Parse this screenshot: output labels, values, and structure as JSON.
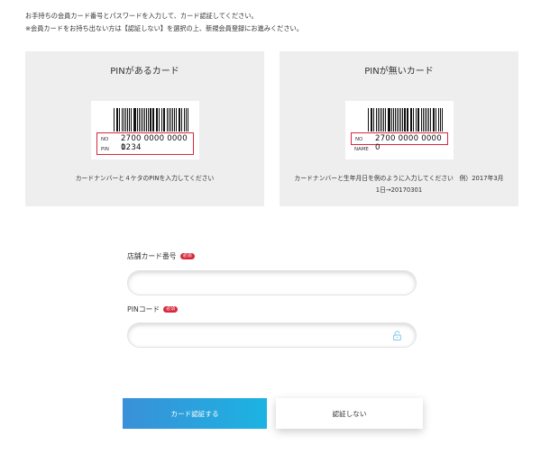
{
  "intro": {
    "line1": "お手持ちの会員カード番号とパスワードを入力して、カード認証してください。",
    "line2": "※会員カードをお持ち出ない方は【認証しない】を選択の上、新規会員登録にお進みください。"
  },
  "card_with_pin": {
    "title": "PINがあるカード",
    "no_label": "NO",
    "no_value": "2700 0000 0000 0",
    "pin_label": "PIN",
    "pin_value": "1234",
    "description": "カードナンバーと４ケタのPINを入力してください"
  },
  "card_without_pin": {
    "title": "PINが無いカード",
    "no_label": "NO",
    "no_value": "2700 0000 0000 0",
    "name_label": "NAME",
    "description_line1": "カードナンバーと生年月日を例のように入力してください　例）2017年3月",
    "description_line2": "1日→20170301"
  },
  "form": {
    "card_number_label": "店舗カード番号",
    "card_number_required": "必須",
    "card_number_value": "",
    "pin_label": "PINコード",
    "pin_required": "必須",
    "pin_value": ""
  },
  "buttons": {
    "authenticate": "カード認証する",
    "skip": "認証しない"
  },
  "colors": {
    "required_badge": "#d8283c",
    "primary_gradient_start": "#3a90d8",
    "primary_gradient_end": "#1cb3e2",
    "panel_bg": "#eeeeee"
  },
  "icons": {
    "pin_field_icon": "lock-icon"
  }
}
